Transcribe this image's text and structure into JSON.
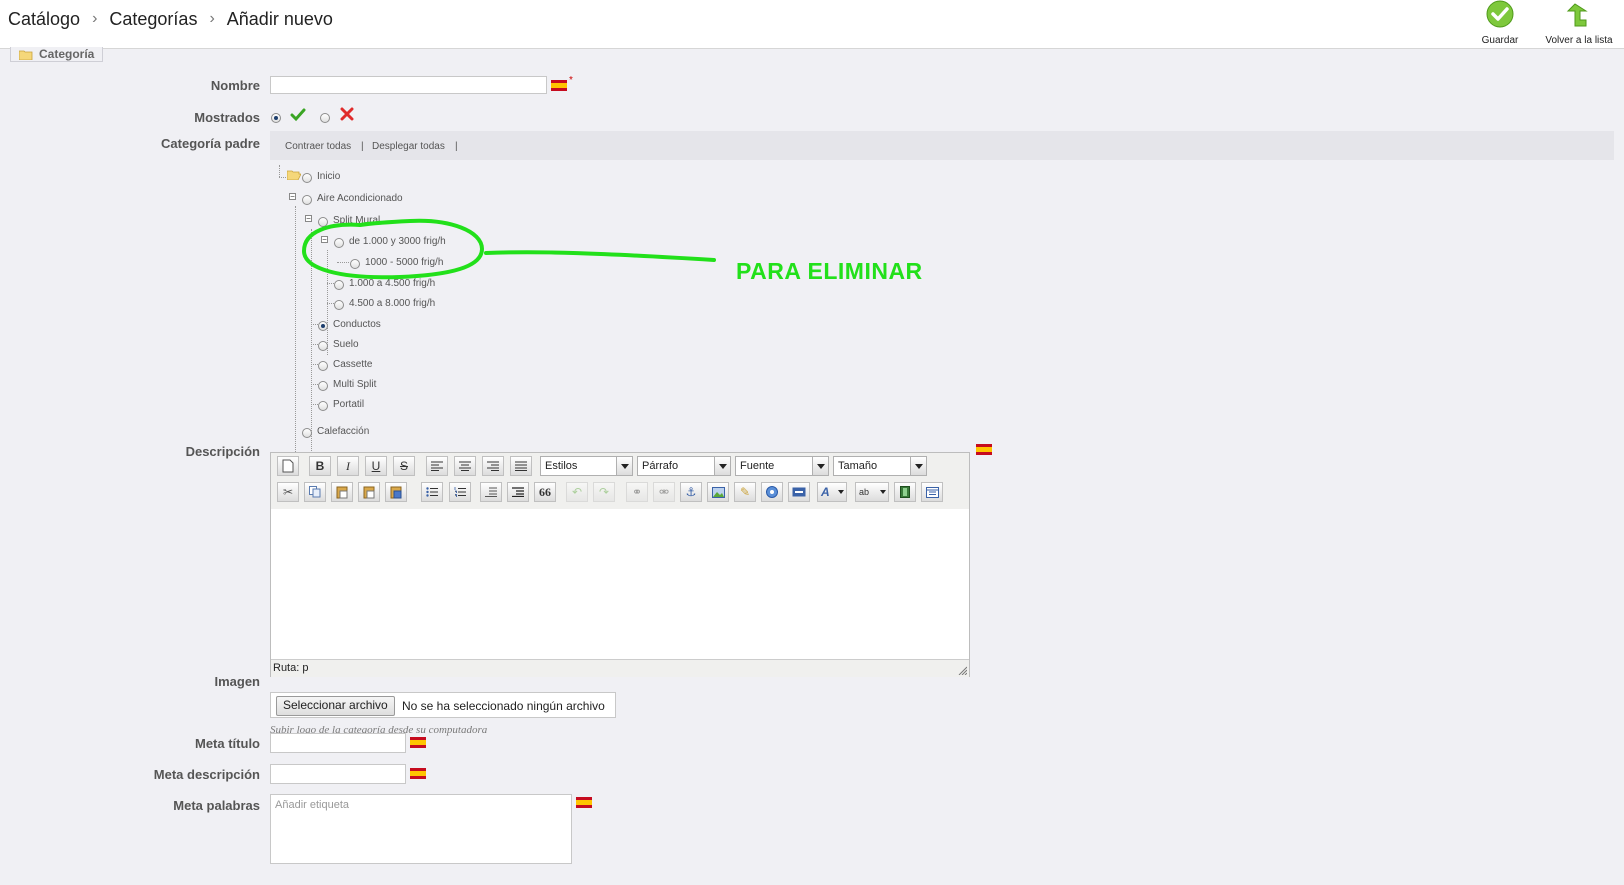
{
  "header": {
    "breadcrumb": [
      "Catálogo",
      "Categorías",
      "Añadir nuevo"
    ],
    "save_label": "Guardar",
    "back_label": "Volver a la lista"
  },
  "form": {
    "legend": "Categoría",
    "name_label": "Nombre",
    "name_value": "",
    "required_mark": "*",
    "displayed_label": "Mostrados",
    "displayed_value": "yes",
    "parent_label": "Categoría padre",
    "collapse_all": "Contraer todas",
    "expand_all": "Desplegar todas",
    "toolbar_sep": "|",
    "tree": [
      {
        "label": "Inicio",
        "checked": false
      },
      {
        "label": "Aire Acondicionado",
        "checked": false
      },
      {
        "label": "Split Mural",
        "checked": false
      },
      {
        "label": "de 1.000 y 3000 frig/h",
        "checked": false
      },
      {
        "label": "1000 - 5000 frig/h",
        "checked": false
      },
      {
        "label": "1.000 a 4.500 frig/h",
        "checked": false
      },
      {
        "label": "4.500 a 8.000 frig/h",
        "checked": false
      },
      {
        "label": "Conductos",
        "checked": true
      },
      {
        "label": "Suelo",
        "checked": false
      },
      {
        "label": "Cassette",
        "checked": false
      },
      {
        "label": "Multi Split",
        "checked": false
      },
      {
        "label": "Portatil",
        "checked": false
      },
      {
        "label": "Calefacción",
        "checked": false
      }
    ],
    "description_label": "Descripción",
    "editor": {
      "styles": "Estilos",
      "paragraph": "Párrafo",
      "font": "Fuente",
      "size": "Tamaño",
      "path": "Ruta: p",
      "bold": "B",
      "italic": "I",
      "underline": "U",
      "strike": "S",
      "quote": "66"
    },
    "image_label": "Imagen",
    "file_button": "Seleccionar archivo",
    "file_status": "No se ha seleccionado ningún archivo",
    "image_help": "Subir logo de la categoría desde su computadora",
    "meta_title_label": "Meta título",
    "meta_title_value": "",
    "meta_desc_label": "Meta descripción",
    "meta_desc_value": "",
    "meta_keywords_label": "Meta palabras",
    "tags_placeholder": "Añadir etiqueta"
  },
  "annotation": {
    "text": "PARA ELIMINAR",
    "color": "#22e01a"
  },
  "icons": [
    "save-icon",
    "back-icon",
    "folder-icon",
    "flag-es-icon",
    "check-icon",
    "cross-icon"
  ]
}
